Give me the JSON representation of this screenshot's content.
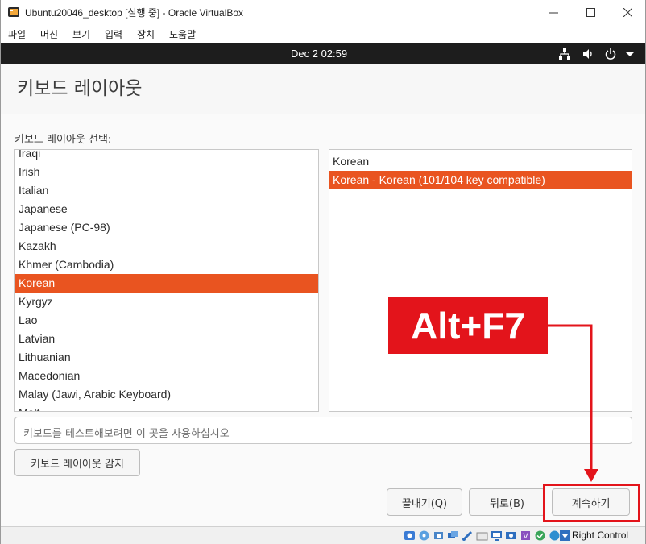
{
  "window": {
    "title": "Ubuntu20046_desktop [실행 중] - Oracle VirtualBox",
    "minimize_icon": "minimize-icon",
    "maximize_icon": "maximize-icon",
    "close_icon": "close-icon"
  },
  "menubar": {
    "items": [
      "파일",
      "머신",
      "보기",
      "입력",
      "장치",
      "도움말"
    ]
  },
  "topbar": {
    "clock": "Dec 2  02:59",
    "icons": [
      "network-icon",
      "volume-icon",
      "power-icon",
      "chevron-down-icon"
    ]
  },
  "installer": {
    "title": "키보드 레이아웃",
    "prompt": "키보드 레이아웃 선택:",
    "layouts": [
      "Iraqi",
      "Irish",
      "Italian",
      "Japanese",
      "Japanese (PC-98)",
      "Kazakh",
      "Khmer (Cambodia)",
      "Korean",
      "Kyrgyz",
      "Lao",
      "Latvian",
      "Lithuanian",
      "Macedonian",
      "Malay (Jawi, Arabic Keyboard)",
      "Malt"
    ],
    "selected_layout": "Korean",
    "variants": [
      "Korean",
      "Korean - Korean (101/104 key compatible)"
    ],
    "selected_variant": "Korean - Korean (101/104 key compatible)",
    "test_placeholder": "키보드를 테스트해보려면 이 곳을 사용하십시오",
    "detect_button": "키보드 레이아웃 감지",
    "quit_button": "끝내기(Q)",
    "back_button": "뒤로(B)",
    "continue_button": "계속하기",
    "accent_color": "#e95420"
  },
  "statusbar": {
    "host_key": "Right Control"
  },
  "annotation": {
    "label": "Alt+F7",
    "color": "#e3141b"
  }
}
